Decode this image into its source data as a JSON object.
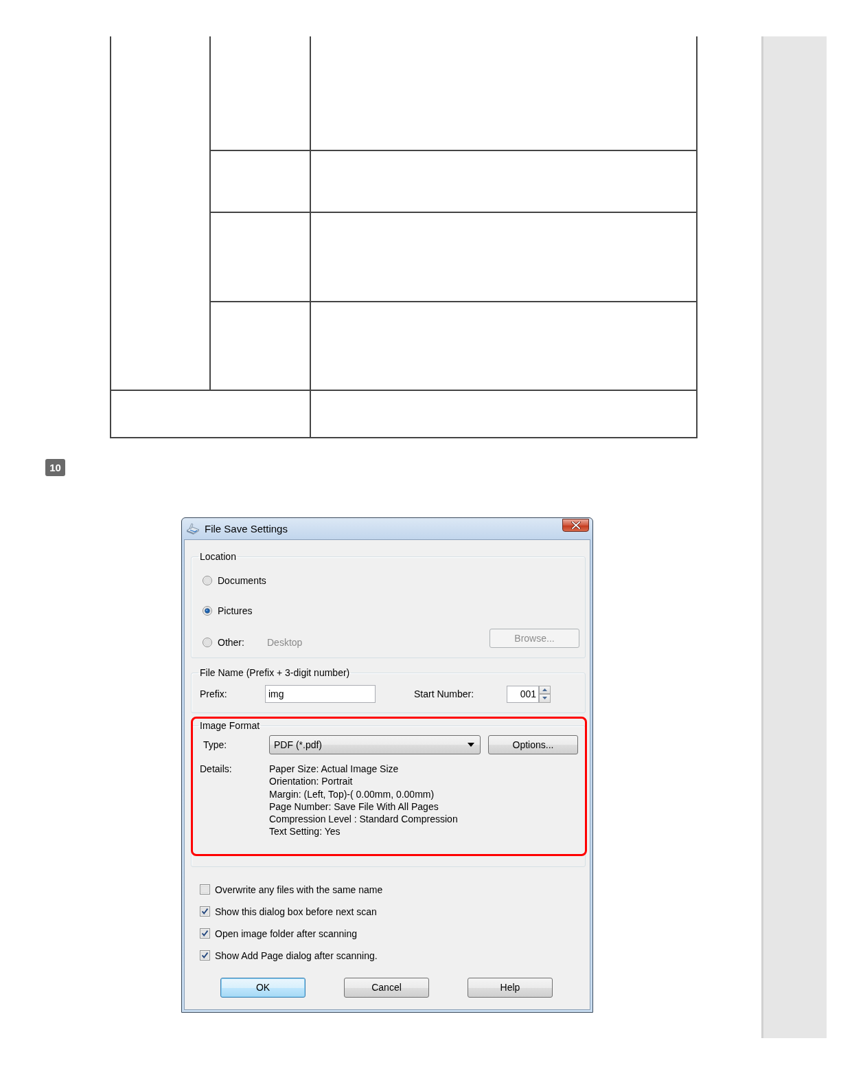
{
  "page": {
    "step_number": "10"
  },
  "dialog": {
    "title": "File Save Settings",
    "location": {
      "label": "Location",
      "options": [
        {
          "label": "Documents",
          "selected": false
        },
        {
          "label": "Pictures",
          "selected": true
        },
        {
          "label": "Other:",
          "selected": false,
          "path": "Desktop"
        }
      ],
      "browse_button": {
        "label": "Browse...",
        "disabled": true
      }
    },
    "file_name": {
      "label": "File Name (Prefix + 3-digit number)",
      "prefix_label": "Prefix:",
      "prefix_value": "img",
      "start_number_label": "Start Number:",
      "start_number_value": "001"
    },
    "image_format": {
      "label": "Image Format",
      "highlighted": true,
      "type_label": "Type:",
      "type_value": "PDF (*.pdf)",
      "options_button": "Options...",
      "details_label": "Details:",
      "details": [
        "Paper Size: Actual Image Size",
        "Orientation: Portrait",
        "Margin: (Left, Top)-( 0.00mm, 0.00mm)",
        "Page Number: Save File With All Pages",
        "Compression Level : Standard Compression",
        "Text Setting: Yes"
      ]
    },
    "checkboxes": [
      {
        "label": "Overwrite any files with the same name",
        "checked": false
      },
      {
        "label": "Show this dialog box before next scan",
        "checked": true
      },
      {
        "label": "Open image folder after scanning",
        "checked": true
      },
      {
        "label": "Show Add Page dialog after scanning.",
        "checked": true
      }
    ],
    "buttons": [
      {
        "label": "OK",
        "default": true
      },
      {
        "label": "Cancel",
        "default": false
      },
      {
        "label": "Help",
        "default": false
      }
    ]
  }
}
